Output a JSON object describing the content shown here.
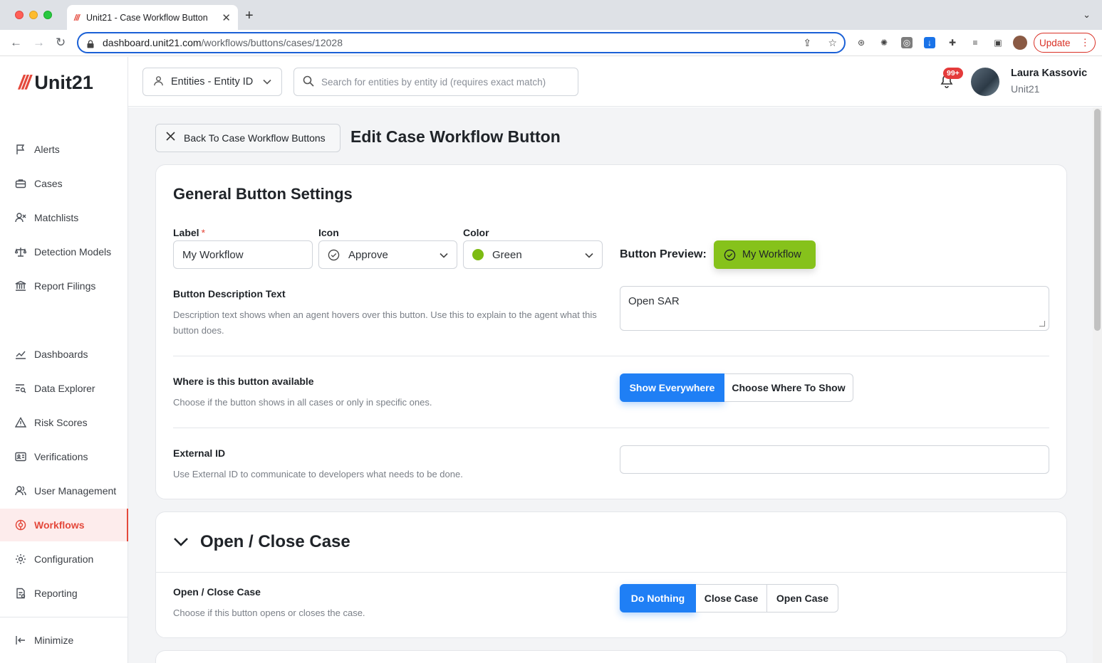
{
  "browser": {
    "tab_title": "Unit21 - Case Workflow Button",
    "tab_favicon": "///",
    "url_host": "dashboard.unit21.com",
    "url_path": "/workflows/buttons/cases/12028",
    "update_label": "Update"
  },
  "app": {
    "logo_text": "Unit21",
    "logo_mark": "///"
  },
  "sidebar": {
    "items": [
      {
        "label": "Alerts",
        "icon": "flag-icon"
      },
      {
        "label": "Cases",
        "icon": "briefcase-icon"
      },
      {
        "label": "Matchlists",
        "icon": "user-x-icon"
      },
      {
        "label": "Detection Models",
        "icon": "scale-icon"
      },
      {
        "label": "Report Filings",
        "icon": "bank-icon"
      },
      {
        "label": "Dashboards",
        "icon": "chart-line-icon"
      },
      {
        "label": "Data Explorer",
        "icon": "table-search-icon"
      },
      {
        "label": "Risk Scores",
        "icon": "alert-triangle-icon"
      },
      {
        "label": "Verifications",
        "icon": "id-card-icon"
      },
      {
        "label": "User Management",
        "icon": "users-icon"
      },
      {
        "label": "Workflows",
        "icon": "workflow-icon",
        "active": true
      },
      {
        "label": "Configuration",
        "icon": "gear-icon"
      },
      {
        "label": "Reporting",
        "icon": "report-icon"
      }
    ],
    "minimize_label": "Minimize"
  },
  "header": {
    "entity_select": "Entities - Entity ID",
    "search_placeholder": "Search for entities by entity id (requires exact match)",
    "notification_count": "99+",
    "user_name": "Laura Kassovic",
    "user_org": "Unit21"
  },
  "page": {
    "back_label": "Back To Case Workflow Buttons",
    "title": "Edit Case Workflow Button"
  },
  "general": {
    "title": "General Button Settings",
    "label_field": {
      "label": "Label",
      "required_mark": "*",
      "value": "My Workflow"
    },
    "icon_field": {
      "label": "Icon",
      "value": "Approve"
    },
    "color_field": {
      "label": "Color",
      "value": "Green",
      "swatch": "#7dbb12"
    },
    "preview_label": "Button Preview:",
    "preview_button": "My Workflow",
    "preview_color": "#86c21b",
    "description": {
      "title": "Button Description Text",
      "help": "Description text shows when an agent hovers over this button. Use this to explain to the agent what this button does.",
      "value": "Open SAR"
    },
    "availability": {
      "title": "Where is this button available",
      "help": "Choose if the button shows in all cases or only in specific ones.",
      "options": [
        "Show Everywhere",
        "Choose Where To Show"
      ],
      "selected": "Show Everywhere"
    },
    "external_id": {
      "title": "External ID",
      "help": "Use External ID to communicate to developers what needs to be done.",
      "value": ""
    }
  },
  "open_close": {
    "title": "Open / Close Case",
    "field_title": "Open / Close Case",
    "help": "Choose if this button opens or closes the case.",
    "options": [
      "Do Nothing",
      "Close Case",
      "Open Case"
    ],
    "selected": "Do Nothing"
  },
  "colors": {
    "brand": "#e4483b",
    "primary": "#1f7ff5"
  }
}
